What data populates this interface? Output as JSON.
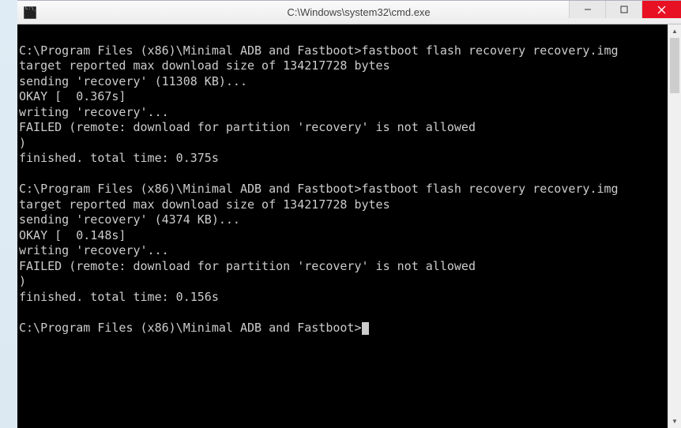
{
  "window": {
    "title": "C:\\Windows\\system32\\cmd.exe"
  },
  "terminal": {
    "lines": [
      "",
      "C:\\Program Files (x86)\\Minimal ADB and Fastboot>fastboot flash recovery recovery.img",
      "target reported max download size of 134217728 bytes",
      "sending 'recovery' (11308 KB)...",
      "OKAY [  0.367s]",
      "writing 'recovery'...",
      "FAILED (remote: download for partition 'recovery' is not allowed",
      ")",
      "finished. total time: 0.375s",
      "",
      "C:\\Program Files (x86)\\Minimal ADB and Fastboot>fastboot flash recovery recovery.img",
      "target reported max download size of 134217728 bytes",
      "sending 'recovery' (4374 KB)...",
      "OKAY [  0.148s]",
      "writing 'recovery'...",
      "FAILED (remote: download for partition 'recovery' is not allowed",
      ")",
      "finished. total time: 0.156s",
      ""
    ],
    "prompt": "C:\\Program Files (x86)\\Minimal ADB and Fastboot>"
  }
}
